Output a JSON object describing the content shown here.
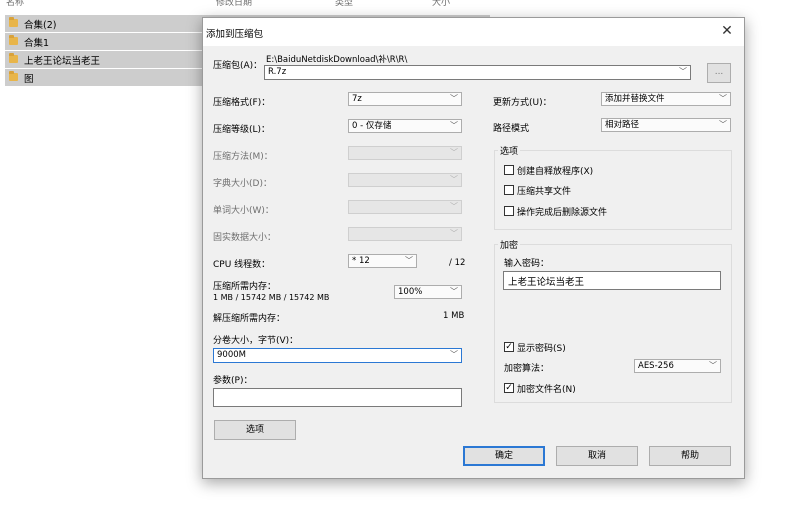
{
  "background": {
    "headers": [
      "名称",
      "修改日期",
      "类型",
      "大小"
    ],
    "items": [
      {
        "name": "合集(2)"
      },
      {
        "name": "合集1"
      },
      {
        "name": "上老王论坛当老王"
      },
      {
        "name": "图"
      }
    ]
  },
  "dialog": {
    "title": "添加到压缩包",
    "close_icon": "close-icon",
    "archive_label": "压缩包(A)：",
    "archive_path": "E:\\BaiduNetdiskDownload\\补\\R\\R\\",
    "archive_name": "R.7z",
    "browse_label": "...",
    "format_label": "压缩格式(F)：",
    "format_value": "7z",
    "level_label": "压缩等级(L)：",
    "level_value": "0 - 仅存储",
    "method_label": "压缩方法(M)：",
    "dict_label": "字典大小(D)：",
    "word_label": "单词大小(W)：",
    "solid_label": "固实数据大小：",
    "threads_label": "CPU 线程数：",
    "threads_value": "* 12",
    "threads_max": "/ 12",
    "mem_comp_label": "压缩所需内存：",
    "mem_comp_value": "1 MB / 15742 MB / 15742 MB",
    "mem_percent": "100%",
    "mem_decomp_label": "解压缩所需内存：",
    "mem_decomp_value": "1 MB",
    "split_label": "分卷大小，字节(V)：",
    "split_value": "9000M",
    "params_label": "参数(P)：",
    "params_value": "",
    "options_button": "选项",
    "update_label": "更新方式(U)：",
    "update_value": "添加并替换文件",
    "path_label": "路径模式",
    "path_value": "相对路径",
    "options_group": "选项",
    "opt_sfx": "创建自释放程序(X)",
    "opt_shared": "压缩共享文件",
    "opt_delete": "操作完成后删除源文件",
    "enc_group": "加密",
    "enc_password_label": "输入密码：",
    "enc_password_value": "上老王论坛当老王",
    "show_password": "显示密码(S)",
    "enc_method_label": "加密算法：",
    "enc_method_value": "AES-256",
    "encrypt_names": "加密文件名(N)",
    "ok": "确定",
    "cancel": "取消",
    "help": "帮助"
  }
}
